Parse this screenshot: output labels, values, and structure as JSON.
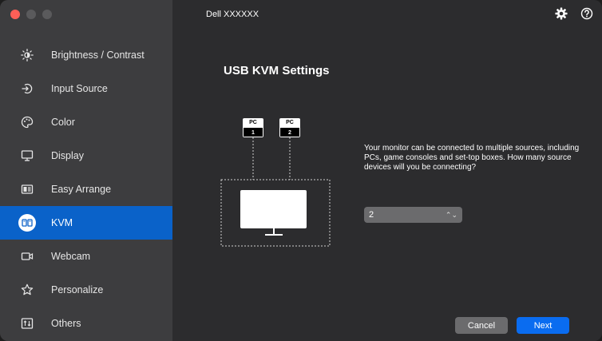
{
  "window": {
    "title": "Dell XXXXXX"
  },
  "sidebar": {
    "items": [
      {
        "label": "Brightness / Contrast",
        "icon": "brightness-icon",
        "active": false
      },
      {
        "label": "Input Source",
        "icon": "input-source-icon",
        "active": false
      },
      {
        "label": "Color",
        "icon": "palette-icon",
        "active": false
      },
      {
        "label": "Display",
        "icon": "monitor-icon",
        "active": false
      },
      {
        "label": "Easy Arrange",
        "icon": "layout-icon",
        "active": false
      },
      {
        "label": "KVM",
        "icon": "kvm-icon",
        "active": true
      },
      {
        "label": "Webcam",
        "icon": "webcam-icon",
        "active": false
      },
      {
        "label": "Personalize",
        "icon": "star-icon",
        "active": false
      },
      {
        "label": "Others",
        "icon": "others-icon",
        "active": false
      }
    ]
  },
  "header": {
    "settings_icon": "gear-icon",
    "help_icon": "help-icon"
  },
  "main": {
    "title": "USB KVM Settings",
    "diagram": {
      "pc1": {
        "label": "PC",
        "number": "1"
      },
      "pc2": {
        "label": "PC",
        "number": "2"
      }
    },
    "description": "Your monitor can be connected to multiple sources, including PCs, game consoles and set-top boxes. How many source devices will you be connecting?",
    "source_count": {
      "value": "2"
    },
    "buttons": {
      "cancel": "Cancel",
      "next": "Next"
    }
  },
  "colors": {
    "accent": "#0a62c9",
    "sidebar_bg": "#3d3d3f",
    "main_bg": "#2c2c2e",
    "next_button": "#0a6cf0"
  }
}
